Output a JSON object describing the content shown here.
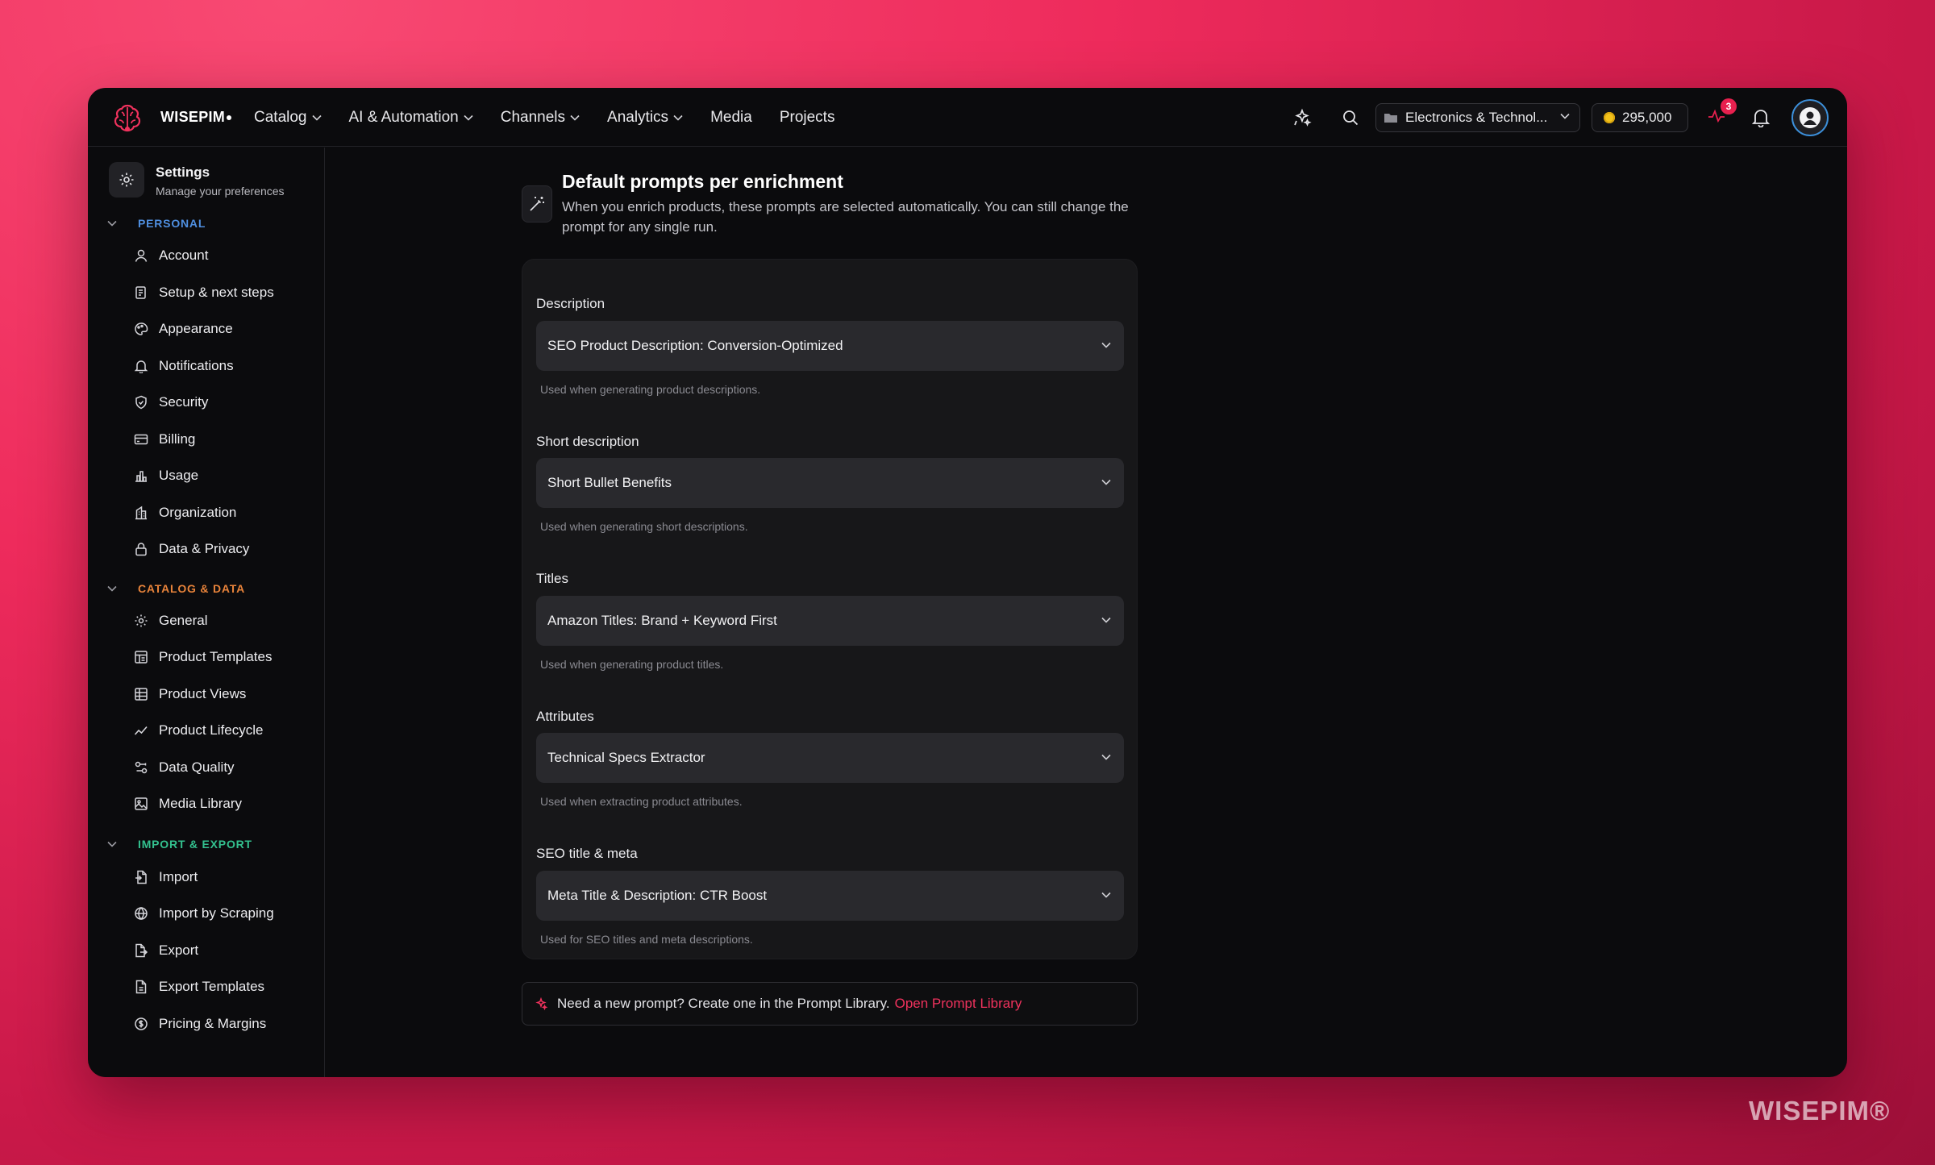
{
  "brand": {
    "name": "WISEPIM"
  },
  "nav": [
    {
      "label": "Catalog",
      "dropdown": true
    },
    {
      "label": "AI & Automation",
      "dropdown": true
    },
    {
      "label": "Channels",
      "dropdown": true
    },
    {
      "label": "Analytics",
      "dropdown": true
    },
    {
      "label": "Media",
      "dropdown": false
    },
    {
      "label": "Projects",
      "dropdown": false
    }
  ],
  "topbar": {
    "workspace": "Electronics & Technol...",
    "credits": "295,000",
    "notification_count": "3"
  },
  "sidebar": {
    "title": "Settings",
    "subtitle": "Manage your preferences",
    "sections": [
      {
        "label": "PERSONAL",
        "color": "#4f8fe0",
        "items": [
          "Account",
          "Setup & next steps",
          "Appearance",
          "Notifications",
          "Security",
          "Billing",
          "Usage",
          "Organization",
          "Data & Privacy"
        ]
      },
      {
        "label": "CATALOG & DATA",
        "color": "#e8833a",
        "items": [
          "General",
          "Product Templates",
          "Product Views",
          "Product Lifecycle",
          "Data Quality",
          "Media Library"
        ]
      },
      {
        "label": "IMPORT & EXPORT",
        "color": "#33c08e",
        "items": [
          "Import",
          "Import by Scraping",
          "Export",
          "Export Templates",
          "Pricing & Margins"
        ]
      }
    ]
  },
  "main": {
    "title": "Default prompts per enrichment",
    "description": "When you enrich products, these prompts are selected automatically. You can still change the prompt for any single run.",
    "fields": [
      {
        "label": "Description",
        "value": "SEO Product Description: Conversion-Optimized",
        "hint": "Used when generating product descriptions."
      },
      {
        "label": "Short description",
        "value": "Short Bullet Benefits",
        "hint": "Used when generating short descriptions."
      },
      {
        "label": "Titles",
        "value": "Amazon Titles: Brand + Keyword First",
        "hint": "Used when generating product titles."
      },
      {
        "label": "Attributes",
        "value": "Technical Specs Extractor",
        "hint": "Used when extracting product attributes."
      },
      {
        "label": "SEO title & meta",
        "value": "Meta Title & Description: CTR Boost",
        "hint": "Used for SEO titles and meta descriptions."
      }
    ],
    "prompt_bar": {
      "text": "Need a new prompt? Create one in the Prompt Library.",
      "link": "Open Prompt Library"
    }
  },
  "watermark": "WISEPIM®",
  "colors": {
    "accent": "#f0325d",
    "background": "#0b0b0d"
  }
}
